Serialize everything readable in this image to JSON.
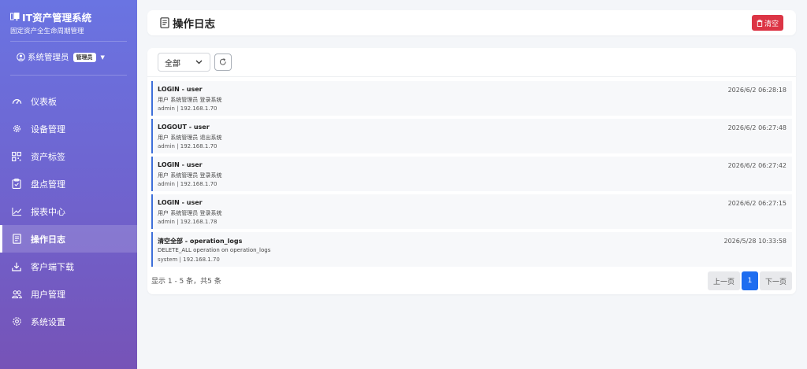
{
  "sidebar": {
    "brand_title": "IT资产管理系统",
    "brand_sub": "固定资产全生命周期管理",
    "user_name": "系统管理员",
    "user_role": "管理员",
    "items": [
      {
        "label": "仪表板",
        "icon": "dashboard-icon"
      },
      {
        "label": "设备管理",
        "icon": "gear-icon"
      },
      {
        "label": "资产标签",
        "icon": "qrcode-icon"
      },
      {
        "label": "盘点管理",
        "icon": "clipboard-check-icon"
      },
      {
        "label": "报表中心",
        "icon": "line-chart-icon"
      },
      {
        "label": "操作日志",
        "icon": "journal-icon",
        "active": true
      },
      {
        "label": "客户端下载",
        "icon": "download-icon"
      },
      {
        "label": "用户管理",
        "icon": "people-icon"
      },
      {
        "label": "系统设置",
        "icon": "settings-icon"
      }
    ]
  },
  "header": {
    "title": "操作日志",
    "clear_label": "清空"
  },
  "filter": {
    "selected": "全部"
  },
  "logs": [
    {
      "title": "LOGIN - user",
      "desc": "用户 系统管理员 登录系统",
      "meta": "admin | 192.168.1.70",
      "time": "2026/6/2 06:28:18"
    },
    {
      "title": "LOGOUT - user",
      "desc": "用户 系统管理员 退出系统",
      "meta": "admin | 192.168.1.70",
      "time": "2026/6/2 06:27:48"
    },
    {
      "title": "LOGIN - user",
      "desc": "用户 系统管理员 登录系统",
      "meta": "admin | 192.168.1.70",
      "time": "2026/6/2 06:27:42"
    },
    {
      "title": "LOGIN - user",
      "desc": "用户 系统管理员 登录系统",
      "meta": "admin | 192.168.1.78",
      "time": "2026/6/2 06:27:15"
    },
    {
      "title": "清空全部 - operation_logs",
      "desc": "DELETE_ALL operation on operation_logs",
      "meta": "system | 192.168.1.70",
      "time": "2026/5/28 10:33:58"
    }
  ],
  "pagination": {
    "info": "显示 1 - 5 条，共5 条",
    "prev_label": "上一页",
    "current_page": "1",
    "next_label": "下一页"
  },
  "colors": {
    "sidebar_top": "#6a74e2",
    "sidebar_bottom": "#7653b7",
    "danger": "#dc3545",
    "primary": "#1e6df0",
    "log_accent": "#3d6fd9"
  }
}
